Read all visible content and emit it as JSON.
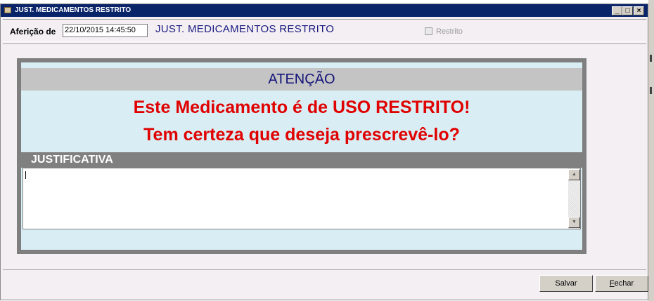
{
  "window": {
    "title": "JUST. MEDICAMENTOS RESTRITO"
  },
  "header": {
    "afericao_label": "Aferição de",
    "afericao_value": "22/10/2015 14:45:50",
    "title": "JUST. MEDICAMENTOS RESTRITO",
    "restrito_label": "Restrito",
    "restrito_checked": false
  },
  "panel": {
    "atencao": "ATENÇÃO",
    "line1": "Este Medicamento é de USO RESTRITO!",
    "line2": "Tem certeza que deseja prescrevê-lo?",
    "justificativa_label": "JUSTIFICATIVA",
    "justificativa_value": ""
  },
  "footer": {
    "salvar_label": "Salvar",
    "fechar_label": "Fechar",
    "fechar_mnemonic": "F",
    "fechar_rest": "echar"
  },
  "colors": {
    "titlebar": "#0a246a",
    "warning_text": "#e00000",
    "header_title": "#1a1a80",
    "panel_background": "#d8eef4"
  },
  "icons": [
    "app-icon",
    "minimize-icon",
    "maximize-icon",
    "close-icon",
    "scroll-up-icon",
    "scroll-down-icon"
  ]
}
